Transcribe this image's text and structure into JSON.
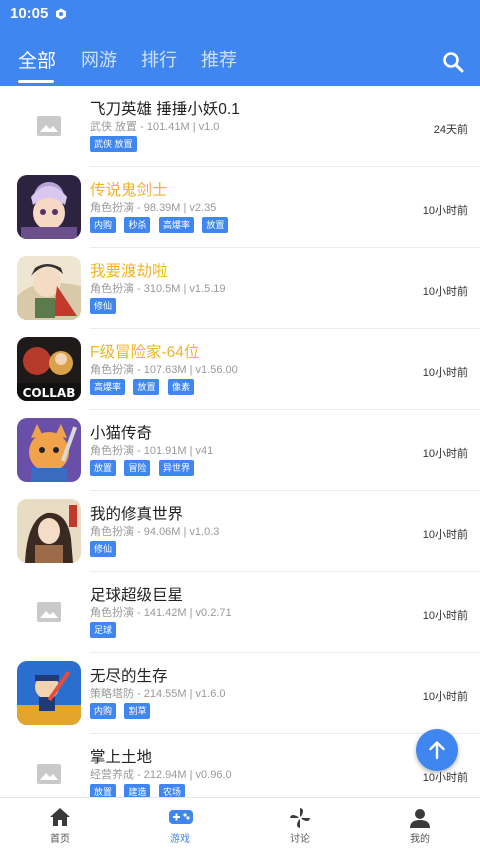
{
  "status_bar": {
    "time": "10:05"
  },
  "tabs": [
    {
      "label": "全部",
      "active": true
    },
    {
      "label": "网游",
      "active": false
    },
    {
      "label": "排行",
      "active": false
    },
    {
      "label": "推荐",
      "active": false
    }
  ],
  "colors": {
    "accent": "#3f86f0",
    "highlight": "#f0b429"
  },
  "games": [
    {
      "name": "飞刀英雄 捶捶小妖0.1",
      "meta": "武侠 放置 - 101.41M | v1.0",
      "tags": [
        "武侠 放置"
      ],
      "time": "24天前",
      "icon": "image-placeholder-icon",
      "highlight": false
    },
    {
      "name": "传说鬼剑士",
      "meta": "角色扮演 - 98.39M | v2.35",
      "tags": [
        "内购",
        "秒杀",
        "高爆率",
        "放置"
      ],
      "time": "10小时前",
      "icon": "game-icon",
      "highlight": true
    },
    {
      "name": "我要渡劫啦",
      "meta": "角色扮演 - 310.5M | v1.5.19",
      "tags": [
        "修仙"
      ],
      "time": "10小时前",
      "icon": "game-icon",
      "highlight": true
    },
    {
      "name": "F级冒险家-64位",
      "meta": "角色扮演 - 107.63M | v1.56.00",
      "tags": [
        "高爆率",
        "放置",
        "像素"
      ],
      "time": "10小时前",
      "icon": "game-icon",
      "highlight": true,
      "icon_caption": "COLLAB"
    },
    {
      "name": "小猫传奇",
      "meta": "角色扮演 - 101.91M | v41",
      "tags": [
        "放置",
        "冒险",
        "异世界"
      ],
      "time": "10小时前",
      "icon": "game-icon",
      "highlight": false
    },
    {
      "name": "我的修真世界",
      "meta": "角色扮演 - 94.06M | v1.0.3",
      "tags": [
        "修仙"
      ],
      "time": "10小时前",
      "icon": "game-icon",
      "highlight": false
    },
    {
      "name": "足球超级巨星",
      "meta": "角色扮演 - 141.42M | v0.2.71",
      "tags": [
        "足球"
      ],
      "time": "10小时前",
      "icon": "image-placeholder-icon",
      "highlight": false
    },
    {
      "name": "无尽的生存",
      "meta": "策略塔防 - 214.55M | v1.6.0",
      "tags": [
        "内购",
        "割草"
      ],
      "time": "10小时前",
      "icon": "game-icon",
      "highlight": false
    },
    {
      "name": "掌上土地",
      "meta": "经营养成 - 212.94M | v0.96.0",
      "tags": [
        "放置",
        "建造",
        "农场"
      ],
      "time": "10小时前",
      "icon": "image-placeholder-icon",
      "highlight": false
    }
  ],
  "bottom_nav": [
    {
      "label": "首页",
      "icon": "home-icon",
      "active": false
    },
    {
      "label": "游戏",
      "icon": "gamepad-icon",
      "active": true
    },
    {
      "label": "讨论",
      "icon": "pinwheel-icon",
      "active": false
    },
    {
      "label": "我的",
      "icon": "user-icon",
      "active": false
    }
  ]
}
